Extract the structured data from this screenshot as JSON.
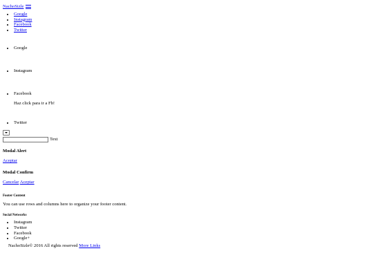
{
  "header": {
    "brand": "NachoSizle"
  },
  "nav": {
    "items": [
      "Google",
      "Instagram",
      "Facebook",
      "Twitter"
    ]
  },
  "sidebar": {
    "google_label": "Google",
    "instagram_label": "Instagram",
    "facebook_label": "Facebook",
    "facebook_hint": "Haz click para ir a Fb!",
    "twitter_label": "Twitter"
  },
  "form": {
    "input_value": "",
    "input_label": "Text"
  },
  "modal_alert": {
    "title": "Modal Alert",
    "accept": "Aceptar"
  },
  "modal_confirm": {
    "title": "Modal Confirm",
    "cancel": "Cancelar",
    "accept": "Aceptar"
  },
  "footer": {
    "title": "Footer Content",
    "text": "You can use rows and columns here to organize your footer content.",
    "social_title": "Social Networks",
    "social_items": [
      "Instagram",
      "Twitter",
      "Facebook",
      "Google+"
    ],
    "copyright": "NachoSizle© 2016 All rights reserved",
    "more_links": "More Links"
  }
}
